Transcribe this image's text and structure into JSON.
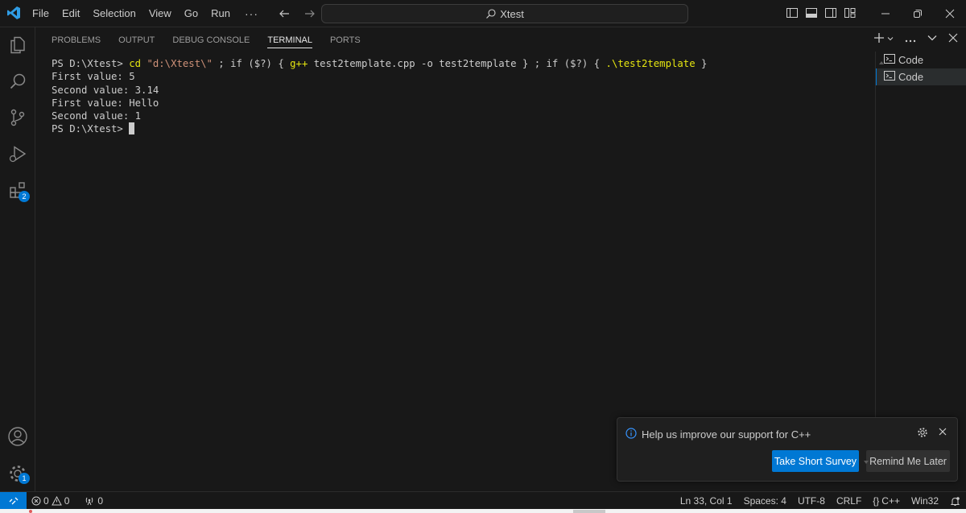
{
  "window": {
    "search_title": "Xtest"
  },
  "menu": [
    "File",
    "Edit",
    "Selection",
    "View",
    "Go",
    "Run"
  ],
  "menu_more": "···",
  "panel": {
    "tabs": [
      "PROBLEMS",
      "OUTPUT",
      "DEBUG CONSOLE",
      "TERMINAL",
      "PORTS"
    ],
    "active_tab": "TERMINAL"
  },
  "terminal": {
    "command": {
      "prompt": "PS D:\\Xtest> ",
      "cd": "cd",
      "path_str": "\"d:\\Xtest\\\"",
      "part1": " ; if ($?) { ",
      "gpp": "g++",
      "part2": " test2template.cpp -o test2template } ; if ($?) { ",
      "run": ".\\test2template",
      "part3": " }"
    },
    "output": [
      "First value: 5",
      "Second value: 3.14",
      "First value: Hello",
      "Second value: 1"
    ],
    "final_prompt": "PS D:\\Xtest> "
  },
  "terminal_list": [
    "Code",
    "Code"
  ],
  "activity_badges": {
    "extensions": "2",
    "manage": "1"
  },
  "notification": {
    "message": "Help us improve our support for C++",
    "primary_button": "Take Short Survey",
    "secondary_button": "Remind Me Later"
  },
  "status": {
    "errors": "0",
    "warnings": "0",
    "ports": "0",
    "position": "Ln 33, Col 1",
    "spaces": "Spaces: 4",
    "encoding": "UTF-8",
    "eol": "CRLF",
    "lang_braces": "{}",
    "language": "C++",
    "platform": "Win32"
  },
  "colors": {
    "accent": "#0078d4",
    "background": "#181818",
    "terminal_yellow": "#e5e510",
    "terminal_string": "#ce9178"
  }
}
